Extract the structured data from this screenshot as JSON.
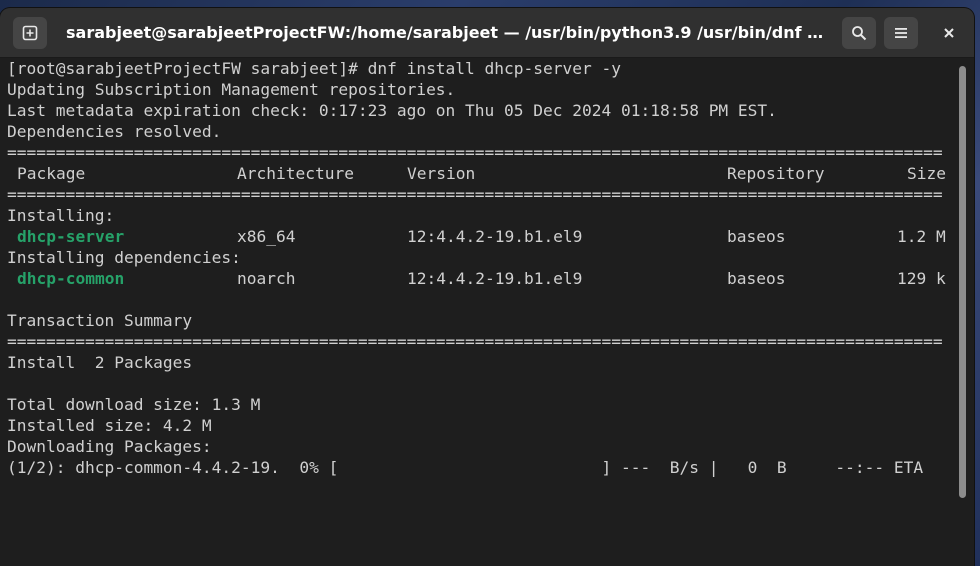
{
  "window": {
    "title": "sarabjeet@sarabjeetProjectFW:/home/sarabjeet — /usr/bin/python3.9 /usr/bin/dnf in…",
    "icons": [
      "new-tab-icon",
      "search-icon",
      "hamburger-menu-icon",
      "close-icon"
    ]
  },
  "terminal": {
    "prompt_line": "[root@sarabjeetProjectFW sarabjeet]# dnf install dhcp-server -y",
    "line_updating": "Updating Subscription Management repositories.",
    "line_metadata": "Last metadata expiration check: 0:17:23 ago on Thu 05 Dec 2024 01:18:58 PM EST.",
    "line_deps": "Dependencies resolved.",
    "separator": "================================================================================================",
    "table_header": {
      "package": "Package",
      "architecture": "Architecture",
      "version": "Version",
      "repository": "Repository",
      "size": "Size"
    },
    "installing_label": "Installing:",
    "installing_deps_label": "Installing dependencies:",
    "packages": [
      {
        "name": "dhcp-server",
        "arch": "x86_64",
        "version": "12:4.4.2-19.b1.el9",
        "repo": "baseos",
        "size": "1.2 M"
      },
      {
        "name": "dhcp-common",
        "arch": "noarch",
        "version": "12:4.4.2-19.b1.el9",
        "repo": "baseos",
        "size": "129 k"
      }
    ],
    "transaction_summary": "Transaction Summary",
    "install_line": "Install  2 Packages",
    "total_download": "Total download size: 1.3 M",
    "installed_size": "Installed size: 4.2 M",
    "downloading": "Downloading Packages:",
    "progress_line": "(1/2): dhcp-common-4.4.2-19.  0% [                           ] ---  B/s |   0  B     --:-- ETA"
  },
  "colors": {
    "package_name": "#26a269",
    "background": "#1e1e1e",
    "headerbar": "#303030"
  }
}
